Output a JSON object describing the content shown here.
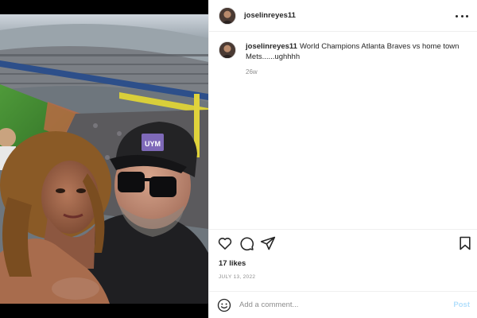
{
  "post": {
    "username": "joselinreyes11",
    "caption": "World Champions Atlanta Braves vs home town Mets......ughhhh",
    "time_ago": "26w",
    "likes": "17 likes",
    "date": "JULY 13, 2022"
  },
  "media": {
    "hat_logo": "UYM"
  },
  "comment_box": {
    "placeholder": "Add a comment...",
    "post_label": "Post"
  },
  "icons": {
    "more": "more-options-icon",
    "like": "heart-icon",
    "comment": "comment-bubble-icon",
    "share": "paper-plane-icon",
    "save": "bookmark-icon",
    "emoji": "smiley-icon"
  },
  "colors": {
    "post_button_disabled": "#b2dffc",
    "secondary_text": "#8e8e8e",
    "primary_text": "#262626"
  }
}
